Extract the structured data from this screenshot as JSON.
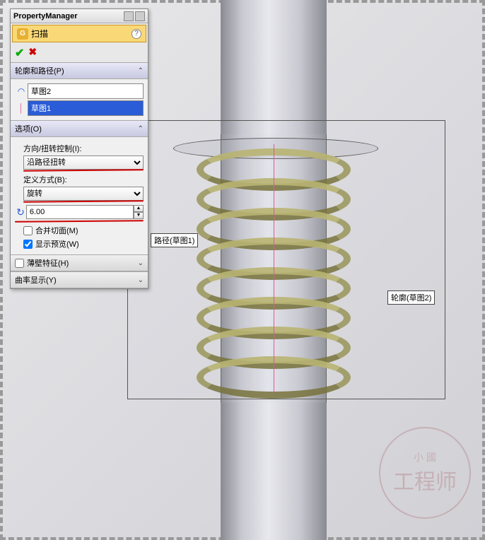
{
  "pm": {
    "title": "PropertyManager"
  },
  "feature": {
    "name": "扫描"
  },
  "sections": {
    "profile_path": {
      "title": "轮廓和路径(P)",
      "profile_field": "草图2",
      "path_field": "草图1"
    },
    "options": {
      "title": "选项(O)",
      "twist_label": "方向/扭转控制(I):",
      "twist_value": "沿路径扭转",
      "defby_label": "定义方式(B):",
      "defby_value": "旋转",
      "turns_value": "6.00",
      "merge_label": "合并切面(M)",
      "merge_checked": false,
      "preview_label": "显示预览(W)",
      "preview_checked": true
    },
    "thin": {
      "title": "薄壁特征(H)",
      "checked": false
    },
    "curv": {
      "title": "曲率显示(Y)"
    }
  },
  "callouts": {
    "path": "路径(草图1)",
    "profile": "轮廓(草图2)"
  },
  "watermark": {
    "small": "小 國",
    "big": "工程师"
  }
}
